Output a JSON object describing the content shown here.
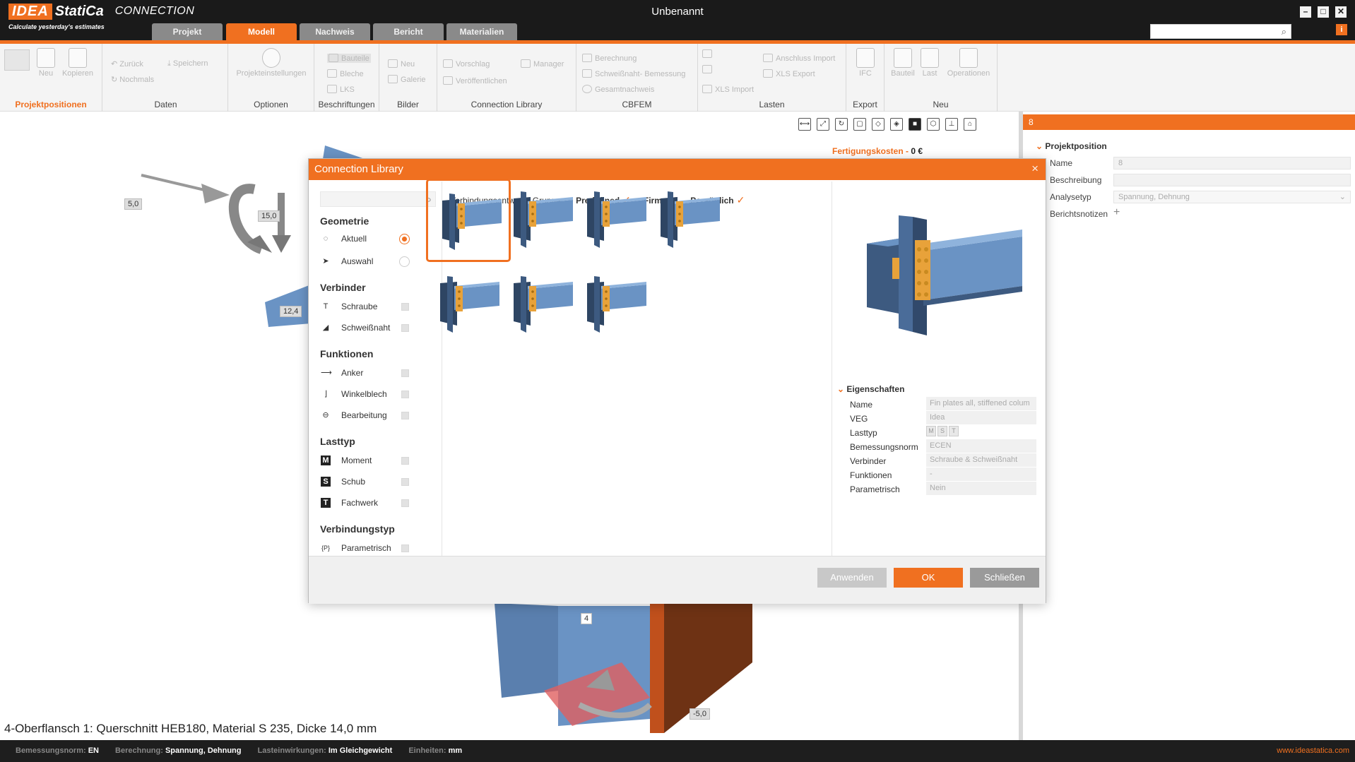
{
  "app": {
    "logo_brand": "IDEA",
    "logo_name": "StatiCa",
    "logo_product": "CONNECTION",
    "tagline": "Calculate yesterday's estimates",
    "doc_title": "Unbenannt",
    "accent": "#f07020"
  },
  "tabs": [
    {
      "label": "Projekt"
    },
    {
      "label": "Modell"
    },
    {
      "label": "Nachweis"
    },
    {
      "label": "Bericht"
    },
    {
      "label": "Materialien"
    }
  ],
  "ribbon": {
    "groups": {
      "projektpositionen": "Projektpositionen",
      "daten": "Daten",
      "optionen": "Optionen",
      "beschriftungen": "Beschriftungen",
      "bilder": "Bilder",
      "connection_library": "Connection Library",
      "cbfem": "CBFEM",
      "lasten": "Lasten",
      "export": "Export",
      "neu": "Neu"
    },
    "items": {
      "neu": "Neu",
      "kopieren": "Kopieren",
      "zurueck": "Zurück",
      "nochmals": "Nochmals",
      "speichern": "Speichern",
      "projekteinstellungen": "Projekteinstellungen",
      "bauteile": "Bauteile",
      "bleche": "Bleche",
      "lks": "LKS",
      "bild_neu": "Neu",
      "galerie": "Galerie",
      "vorschlag": "Vorschlag",
      "manager": "Manager",
      "veroeffentlichen": "Veröffentlichen",
      "berechnung": "Berechnung",
      "schweissnaht_bemessung": "Schweißnaht- Bemessung",
      "gesamtnachweis": "Gesamtnachweis",
      "anschluss_import": "Anschluss Import",
      "xls_export": "XLS Export",
      "xls_import": "XLS Import",
      "ifc": "IFC",
      "bauteil": "Bauteil",
      "last": "Last",
      "operationen": "Operationen"
    }
  },
  "viewport": {
    "cost_label": "Fertigungskosten",
    "cost_sep": "-",
    "cost_value": "0 €",
    "labels": {
      "a": "5,0",
      "b": "15,0",
      "c": "12,4",
      "d": "4",
      "e": "-5,0"
    },
    "status_line": "4-Oberflansch 1: Querschnitt HEB180, Material S 235, Dicke 14,0 mm"
  },
  "right_panel": {
    "header": "8",
    "section": "Projektposition",
    "fields": [
      {
        "label": "Name",
        "value": "8"
      },
      {
        "label": "Beschreibung",
        "value": ""
      },
      {
        "label": "Analysetyp",
        "value": "Spannung, Dehnung"
      },
      {
        "label": "Berichtsnotizen",
        "value": "+"
      }
    ]
  },
  "dialog": {
    "title": "Connection Library",
    "close": "×",
    "search_placeholder": "",
    "group_label": "Verbindungsentwurf - Gruppe:",
    "groups": [
      {
        "label": "Predefined",
        "checked": true
      },
      {
        "label": "Firma",
        "checked": true
      },
      {
        "label": "Persönlich",
        "checked": true
      }
    ],
    "filters": {
      "geometrie": "Geometrie",
      "aktuell": "Aktuell",
      "auswahl": "Auswahl",
      "verbinder": "Verbinder",
      "schraube": "Schraube",
      "schweissnaht": "Schweißnaht",
      "funktionen": "Funktionen",
      "anker": "Anker",
      "winkelblech": "Winkelblech",
      "bearbeitung": "Bearbeitung",
      "lasttyp": "Lasttyp",
      "moment": "Moment",
      "schub": "Schub",
      "fachwerk": "Fachwerk",
      "verbindungstyp": "Verbindungstyp",
      "parametrisch": "Parametrisch",
      "icon_m": "M",
      "icon_s": "S",
      "icon_t": "T",
      "icon_p": "{P}"
    },
    "properties": {
      "title": "Eigenschaften",
      "rows": [
        {
          "label": "Name",
          "value": "Fin plates all, stiffened colum"
        },
        {
          "label": "VEG",
          "value": "Idea"
        },
        {
          "label": "Lasttyp",
          "value": ""
        },
        {
          "label": "Bemessungsnorm",
          "value": "ECEN"
        },
        {
          "label": "Verbinder",
          "value": "Schraube & Schweißnaht"
        },
        {
          "label": "Funktionen",
          "value": "-"
        },
        {
          "label": "Parametrisch",
          "value": "Nein"
        }
      ],
      "lasttyp_badges": [
        "M",
        "S",
        "T"
      ]
    },
    "buttons": {
      "anwenden": "Anwenden",
      "ok": "OK",
      "schliessen": "Schließen"
    }
  },
  "statusbar": {
    "norm_k": "Bemessungsnorm:",
    "norm_v": "EN",
    "calc_k": "Berechnung:",
    "calc_v": "Spannung, Dehnung",
    "load_k": "Lasteinwirkungen:",
    "load_v": "Im Gleichgewicht",
    "unit_k": "Einheiten:",
    "unit_v": "mm",
    "website": "www.ideastatica.com"
  }
}
